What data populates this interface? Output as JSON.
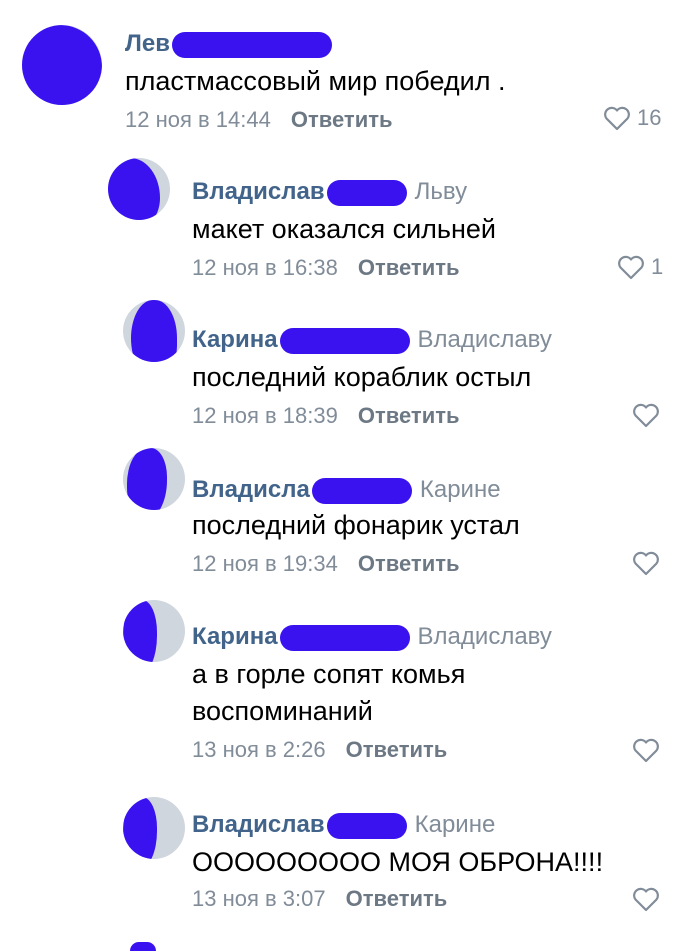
{
  "colors": {
    "redaction": "#3a12f0",
    "author": "#42648b",
    "secondary": "#818c99"
  },
  "comments": [
    {
      "author": "Лев",
      "reply_to": "",
      "text": "пластмассовый мир победил .",
      "date": "12 ноя в 14:44",
      "reply_label": "Ответить",
      "likes": "16"
    },
    {
      "author": "Владислав",
      "reply_to": "Льву",
      "text": "макет оказался сильней",
      "date": "12 ноя в 16:38",
      "reply_label": "Ответить",
      "likes": "1"
    },
    {
      "author": "Карина",
      "reply_to": "Владиславу",
      "text": "последний кораблик остыл",
      "date": "12 ноя в 18:39",
      "reply_label": "Ответить",
      "likes": ""
    },
    {
      "author": "Владисла",
      "reply_to": "Карине",
      "text": "последний фонарик устал",
      "date": "12 ноя в 19:34",
      "reply_label": "Ответить",
      "likes": ""
    },
    {
      "author": "Карина",
      "reply_to": "Владиславу",
      "text": "а в горле сопят комья воспоминаний",
      "date": "13 ноя в 2:26",
      "reply_label": "Ответить",
      "likes": ""
    },
    {
      "author": "Владислав",
      "reply_to": "Карине",
      "text": "ООООООООО МОЯ ОБРОНА!!!!",
      "date": "13 ноя в 3:07",
      "reply_label": "Ответить",
      "likes": ""
    }
  ]
}
